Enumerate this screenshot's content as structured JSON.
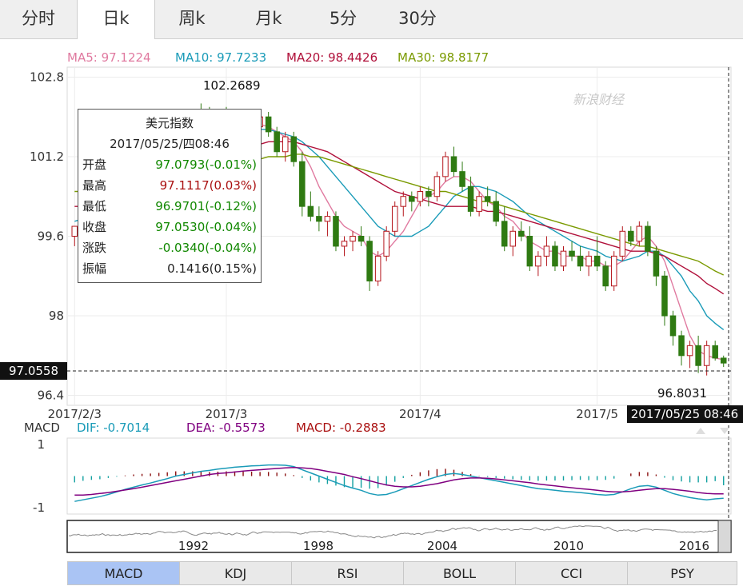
{
  "tabs": [
    {
      "label": "分时",
      "active": false
    },
    {
      "label": "日k",
      "active": true
    },
    {
      "label": "周k",
      "active": false
    },
    {
      "label": "月k",
      "active": false
    },
    {
      "label": "5分",
      "active": false
    },
    {
      "label": "30分",
      "active": false
    }
  ],
  "ma_legend": [
    {
      "text": "MA5: 97.1224",
      "color": "#e07aa0"
    },
    {
      "text": "MA10: 97.7233",
      "color": "#1a9bb8"
    },
    {
      "text": "MA20: 98.4426",
      "color": "#b0103a"
    },
    {
      "text": "MA30: 98.8177",
      "color": "#7a9a00"
    }
  ],
  "watermark": "新浪财经",
  "tooltip": {
    "title": "美元指数",
    "datetime": "2017/05/25/四08:46",
    "rows": [
      {
        "label": "开盘",
        "value": "97.0793(-0.01%)",
        "color": "#118800"
      },
      {
        "label": "最高",
        "value": "97.1117(0.03%)",
        "color": "#aa1111"
      },
      {
        "label": "最低",
        "value": "96.9701(-0.12%)",
        "color": "#118800"
      },
      {
        "label": "收盘",
        "value": "97.0530(-0.04%)",
        "color": "#118800"
      },
      {
        "label": "涨跌",
        "value": "-0.0340(-0.04%)",
        "color": "#118800"
      },
      {
        "label": "振幅",
        "value": "0.1416(0.15%)",
        "color": "#222222"
      }
    ]
  },
  "price_tag": "97.0558",
  "time_tag": "2017/05/25 08:46",
  "high_label": "102.2689",
  "low_label": "96.8031",
  "macd_legend": [
    {
      "text": "MACD",
      "color": "#333333"
    },
    {
      "text": "DIF: -0.7014",
      "color": "#1a9bb8"
    },
    {
      "text": "DEA: -0.5573",
      "color": "#800080"
    },
    {
      "text": "MACD: -0.2883",
      "color": "#aa1111"
    }
  ],
  "buttons": [
    {
      "label": "MACD",
      "active": true
    },
    {
      "label": "KDJ",
      "active": false
    },
    {
      "label": "RSI",
      "active": false
    },
    {
      "label": "BOLL",
      "active": false
    },
    {
      "label": "CCI",
      "active": false
    },
    {
      "label": "PSY",
      "active": false
    }
  ],
  "chart_data": {
    "type": "candlestick",
    "y_ticks": [
      "102.8",
      "101.2",
      "99.6",
      "98",
      "96.4"
    ],
    "y_tick_values": [
      102.8,
      101.2,
      99.6,
      98,
      96.4
    ],
    "ylim": [
      96.2,
      103.0
    ],
    "x_ticks": [
      {
        "label": "2017/2/3",
        "index": 0
      },
      {
        "label": "2017/3",
        "index": 18
      },
      {
        "label": "2017/4",
        "index": 41
      },
      {
        "label": "2017/5",
        "index": 62
      }
    ],
    "candles": [
      [
        99.6,
        99.8,
        99.4,
        99.8
      ],
      [
        99.8,
        100.0,
        99.6,
        99.9
      ],
      [
        99.9,
        100.3,
        99.7,
        100.2
      ],
      [
        100.2,
        100.5,
        100.0,
        100.4
      ],
      [
        100.4,
        100.6,
        100.1,
        100.2
      ],
      [
        100.2,
        100.8,
        100.1,
        100.7
      ],
      [
        100.7,
        101.0,
        100.5,
        100.8
      ],
      [
        100.8,
        101.2,
        100.6,
        101.1
      ],
      [
        101.1,
        101.3,
        100.8,
        100.9
      ],
      [
        100.9,
        101.4,
        100.8,
        101.3
      ],
      [
        101.3,
        101.5,
        101.1,
        101.2
      ],
      [
        101.2,
        101.7,
        101.0,
        101.6
      ],
      [
        101.6,
        101.9,
        101.4,
        101.8
      ],
      [
        101.8,
        102.0,
        101.5,
        101.6
      ],
      [
        101.6,
        102.1,
        101.5,
        102.0
      ],
      [
        102.0,
        102.27,
        101.7,
        101.9
      ],
      [
        101.9,
        102.2,
        101.6,
        101.7
      ],
      [
        101.7,
        102.1,
        101.5,
        102.0
      ],
      [
        102.0,
        102.2,
        101.7,
        101.8
      ],
      [
        101.8,
        102.1,
        101.6,
        102.0
      ],
      [
        102.0,
        102.1,
        101.4,
        101.5
      ],
      [
        101.5,
        101.9,
        101.3,
        101.8
      ],
      [
        101.8,
        102.1,
        101.6,
        102.0
      ],
      [
        102.0,
        102.1,
        101.6,
        101.7
      ],
      [
        101.7,
        101.8,
        101.2,
        101.3
      ],
      [
        101.3,
        101.7,
        101.1,
        101.6
      ],
      [
        101.6,
        101.7,
        101.0,
        101.1
      ],
      [
        101.1,
        101.3,
        100.0,
        100.2
      ],
      [
        100.2,
        100.5,
        99.9,
        100.0
      ],
      [
        100.0,
        100.2,
        99.7,
        99.9
      ],
      [
        99.9,
        100.1,
        99.6,
        100.0
      ],
      [
        100.0,
        100.1,
        99.3,
        99.4
      ],
      [
        99.4,
        99.6,
        99.2,
        99.5
      ],
      [
        99.5,
        99.7,
        99.3,
        99.6
      ],
      [
        99.6,
        99.8,
        99.4,
        99.5
      ],
      [
        99.5,
        99.6,
        98.5,
        98.7
      ],
      [
        98.7,
        99.3,
        98.6,
        99.2
      ],
      [
        99.2,
        99.8,
        99.1,
        99.7
      ],
      [
        99.7,
        100.3,
        99.6,
        100.2
      ],
      [
        100.2,
        100.5,
        100.0,
        100.4
      ],
      [
        100.4,
        100.5,
        100.1,
        100.3
      ],
      [
        100.3,
        100.6,
        100.2,
        100.5
      ],
      [
        100.5,
        100.6,
        100.2,
        100.4
      ],
      [
        100.4,
        100.9,
        100.3,
        100.8
      ],
      [
        100.8,
        101.3,
        100.7,
        101.2
      ],
      [
        101.2,
        101.4,
        100.8,
        100.9
      ],
      [
        100.9,
        101.1,
        100.5,
        100.6
      ],
      [
        100.6,
        100.8,
        100.0,
        100.1
      ],
      [
        100.1,
        100.5,
        100.0,
        100.4
      ],
      [
        100.4,
        100.6,
        100.2,
        100.3
      ],
      [
        100.3,
        100.5,
        99.8,
        99.9
      ],
      [
        99.9,
        100.2,
        99.3,
        99.4
      ],
      [
        99.4,
        99.8,
        99.2,
        99.7
      ],
      [
        99.7,
        99.9,
        99.5,
        99.6
      ],
      [
        99.6,
        99.8,
        98.9,
        99.0
      ],
      [
        99.0,
        99.3,
        98.8,
        99.2
      ],
      [
        99.2,
        99.6,
        99.0,
        99.4
      ],
      [
        99.4,
        99.5,
        98.9,
        99.0
      ],
      [
        99.0,
        99.4,
        98.9,
        99.3
      ],
      [
        99.3,
        99.5,
        99.1,
        99.2
      ],
      [
        99.2,
        99.4,
        98.9,
        99.0
      ],
      [
        99.0,
        99.3,
        98.8,
        99.2
      ],
      [
        99.2,
        99.6,
        98.9,
        99.0
      ],
      [
        99.0,
        99.1,
        98.5,
        98.6
      ],
      [
        98.6,
        99.3,
        98.5,
        99.2
      ],
      [
        99.2,
        99.8,
        99.1,
        99.7
      ],
      [
        99.7,
        99.8,
        99.4,
        99.5
      ],
      [
        99.5,
        99.9,
        99.4,
        99.8
      ],
      [
        99.8,
        99.9,
        99.2,
        99.3
      ],
      [
        99.3,
        99.4,
        98.6,
        98.8
      ],
      [
        98.8,
        98.9,
        97.8,
        98.0
      ],
      [
        98.0,
        98.1,
        97.4,
        97.6
      ],
      [
        97.6,
        97.7,
        97.0,
        97.2
      ],
      [
        97.2,
        97.5,
        96.95,
        97.4
      ],
      [
        97.4,
        97.6,
        96.85,
        97.0
      ],
      [
        97.0,
        97.5,
        96.8,
        97.4
      ],
      [
        97.4,
        97.5,
        97.1,
        97.15
      ],
      [
        97.15,
        97.2,
        96.97,
        97.05
      ]
    ],
    "ma_lines": {
      "MA5": [
        99.6,
        99.7,
        99.9,
        100.1,
        100.3,
        100.4,
        100.6,
        100.8,
        100.9,
        101.1,
        101.2,
        101.4,
        101.5,
        101.6,
        101.7,
        101.8,
        101.85,
        101.85,
        101.8,
        101.85,
        101.8,
        101.8,
        101.85,
        101.8,
        101.7,
        101.6,
        101.5,
        101.3,
        101.0,
        100.6,
        100.3,
        100.0,
        99.8,
        99.7,
        99.6,
        99.3,
        99.2,
        99.3,
        99.5,
        99.7,
        100.0,
        100.3,
        100.4,
        100.5,
        100.7,
        100.8,
        100.8,
        100.7,
        100.5,
        100.3,
        100.2,
        100.0,
        99.9,
        99.7,
        99.5,
        99.4,
        99.3,
        99.3,
        99.2,
        99.2,
        99.2,
        99.1,
        99.1,
        99.0,
        99.0,
        99.1,
        99.3,
        99.5,
        99.6,
        99.4,
        99.1,
        98.6,
        98.1,
        97.6,
        97.3,
        97.2,
        97.15,
        97.12
      ],
      "MA10": [
        99.9,
        99.95,
        100.0,
        100.1,
        100.2,
        100.3,
        100.4,
        100.5,
        100.6,
        100.7,
        100.8,
        100.9,
        101.0,
        101.2,
        101.3,
        101.4,
        101.5,
        101.6,
        101.6,
        101.7,
        101.7,
        101.75,
        101.75,
        101.75,
        101.7,
        101.65,
        101.6,
        101.5,
        101.35,
        101.2,
        101.0,
        100.8,
        100.6,
        100.4,
        100.2,
        100.0,
        99.8,
        99.7,
        99.6,
        99.6,
        99.6,
        99.7,
        99.8,
        100.0,
        100.2,
        100.4,
        100.5,
        100.6,
        100.6,
        100.55,
        100.5,
        100.4,
        100.3,
        100.15,
        100.0,
        99.9,
        99.8,
        99.7,
        99.6,
        99.5,
        99.4,
        99.35,
        99.3,
        99.2,
        99.15,
        99.1,
        99.15,
        99.2,
        99.3,
        99.3,
        99.2,
        99.0,
        98.8,
        98.5,
        98.3,
        98.0,
        97.85,
        97.72
      ],
      "MA20": [
        100.2,
        100.2,
        100.25,
        100.3,
        100.35,
        100.4,
        100.45,
        100.5,
        100.55,
        100.6,
        100.7,
        100.8,
        100.85,
        100.9,
        101.0,
        101.05,
        101.1,
        101.2,
        101.25,
        101.3,
        101.35,
        101.4,
        101.45,
        101.5,
        101.5,
        101.5,
        101.5,
        101.45,
        101.4,
        101.35,
        101.3,
        101.2,
        101.1,
        101.0,
        100.9,
        100.8,
        100.7,
        100.6,
        100.5,
        100.45,
        100.4,
        100.35,
        100.3,
        100.25,
        100.2,
        100.2,
        100.2,
        100.2,
        100.15,
        100.1,
        100.1,
        100.05,
        100.0,
        99.95,
        99.9,
        99.85,
        99.8,
        99.75,
        99.7,
        99.65,
        99.6,
        99.55,
        99.5,
        99.45,
        99.4,
        99.35,
        99.3,
        99.3,
        99.3,
        99.25,
        99.2,
        99.1,
        99.0,
        98.9,
        98.8,
        98.65,
        98.55,
        98.44
      ],
      "MA30": [
        100.5,
        100.5,
        100.5,
        100.5,
        100.5,
        100.55,
        100.6,
        100.6,
        100.65,
        100.7,
        100.7,
        100.75,
        100.8,
        100.8,
        100.85,
        100.9,
        100.9,
        100.95,
        101.0,
        101.0,
        101.05,
        101.1,
        101.15,
        101.2,
        101.2,
        101.2,
        101.25,
        101.25,
        101.2,
        101.2,
        101.15,
        101.1,
        101.05,
        101.0,
        100.95,
        100.9,
        100.85,
        100.8,
        100.75,
        100.7,
        100.65,
        100.6,
        100.55,
        100.5,
        100.5,
        100.45,
        100.4,
        100.35,
        100.3,
        100.3,
        100.25,
        100.2,
        100.15,
        100.1,
        100.05,
        100.0,
        99.95,
        99.9,
        99.85,
        99.8,
        99.75,
        99.7,
        99.65,
        99.6,
        99.55,
        99.5,
        99.45,
        99.4,
        99.4,
        99.35,
        99.3,
        99.25,
        99.2,
        99.15,
        99.1,
        99.0,
        98.9,
        98.82
      ]
    },
    "macd": {
      "ylim": [
        -1.2,
        1.2
      ],
      "y_ticks": [
        "1",
        "-1"
      ],
      "y_tick_values": [
        1,
        -1
      ],
      "x_ticks": [
        {
          "label": "1992",
          "index": 24
        },
        {
          "label": "1998",
          "index": 47
        },
        {
          "label": "2004",
          "index": 72
        },
        {
          "label": "2010",
          "index": 96
        },
        {
          "label": "2016",
          "index": 120
        }
      ],
      "dif": [
        -0.8,
        -0.75,
        -0.7,
        -0.65,
        -0.58,
        -0.5,
        -0.42,
        -0.35,
        -0.28,
        -0.22,
        -0.15,
        -0.08,
        0.0,
        0.05,
        0.1,
        0.15,
        0.18,
        0.22,
        0.25,
        0.28,
        0.3,
        0.32,
        0.33,
        0.35,
        0.35,
        0.34,
        0.3,
        0.2,
        0.1,
        0.0,
        -0.1,
        -0.2,
        -0.3,
        -0.38,
        -0.45,
        -0.55,
        -0.6,
        -0.58,
        -0.5,
        -0.4,
        -0.3,
        -0.2,
        -0.1,
        -0.02,
        0.05,
        0.08,
        0.05,
        0.0,
        -0.05,
        -0.1,
        -0.15,
        -0.2,
        -0.25,
        -0.3,
        -0.35,
        -0.4,
        -0.42,
        -0.45,
        -0.48,
        -0.5,
        -0.52,
        -0.55,
        -0.58,
        -0.6,
        -0.58,
        -0.5,
        -0.4,
        -0.32,
        -0.3,
        -0.35,
        -0.45,
        -0.55,
        -0.62,
        -0.68,
        -0.72,
        -0.75,
        -0.72,
        -0.7
      ],
      "dea": [
        -0.6,
        -0.6,
        -0.58,
        -0.55,
        -0.52,
        -0.48,
        -0.44,
        -0.4,
        -0.35,
        -0.3,
        -0.25,
        -0.2,
        -0.15,
        -0.1,
        -0.05,
        0.0,
        0.05,
        0.08,
        0.1,
        0.13,
        0.16,
        0.18,
        0.2,
        0.22,
        0.24,
        0.26,
        0.27,
        0.26,
        0.24,
        0.2,
        0.15,
        0.1,
        0.05,
        -0.02,
        -0.08,
        -0.15,
        -0.22,
        -0.28,
        -0.32,
        -0.34,
        -0.34,
        -0.32,
        -0.28,
        -0.24,
        -0.18,
        -0.12,
        -0.08,
        -0.06,
        -0.06,
        -0.07,
        -0.09,
        -0.12,
        -0.15,
        -0.18,
        -0.21,
        -0.25,
        -0.28,
        -0.31,
        -0.34,
        -0.37,
        -0.4,
        -0.42,
        -0.45,
        -0.48,
        -0.5,
        -0.5,
        -0.48,
        -0.45,
        -0.42,
        -0.4,
        -0.4,
        -0.42,
        -0.45,
        -0.48,
        -0.52,
        -0.55,
        -0.56,
        -0.56
      ],
      "hist": [
        -0.2,
        -0.15,
        -0.12,
        -0.1,
        -0.06,
        -0.02,
        0.02,
        0.05,
        0.07,
        0.08,
        0.1,
        0.12,
        0.15,
        0.15,
        0.15,
        0.15,
        0.13,
        0.14,
        0.15,
        0.15,
        0.14,
        0.14,
        0.13,
        0.13,
        0.11,
        0.08,
        0.03,
        -0.06,
        -0.14,
        -0.2,
        -0.25,
        -0.3,
        -0.35,
        -0.36,
        -0.37,
        -0.4,
        -0.38,
        -0.3,
        -0.18,
        -0.06,
        0.04,
        0.12,
        0.18,
        0.22,
        0.23,
        0.2,
        0.13,
        0.06,
        0.01,
        -0.03,
        -0.06,
        -0.08,
        -0.1,
        -0.12,
        -0.14,
        -0.15,
        -0.14,
        -0.14,
        -0.14,
        -0.13,
        -0.12,
        -0.13,
        -0.13,
        -0.12,
        -0.08,
        0.0,
        0.08,
        0.13,
        0.12,
        0.05,
        -0.05,
        -0.13,
        -0.17,
        -0.2,
        -0.2,
        -0.2,
        -0.16,
        -0.29
      ]
    },
    "overview_ticks": [
      "1992",
      "1998",
      "2004",
      "2010",
      "2016"
    ]
  }
}
